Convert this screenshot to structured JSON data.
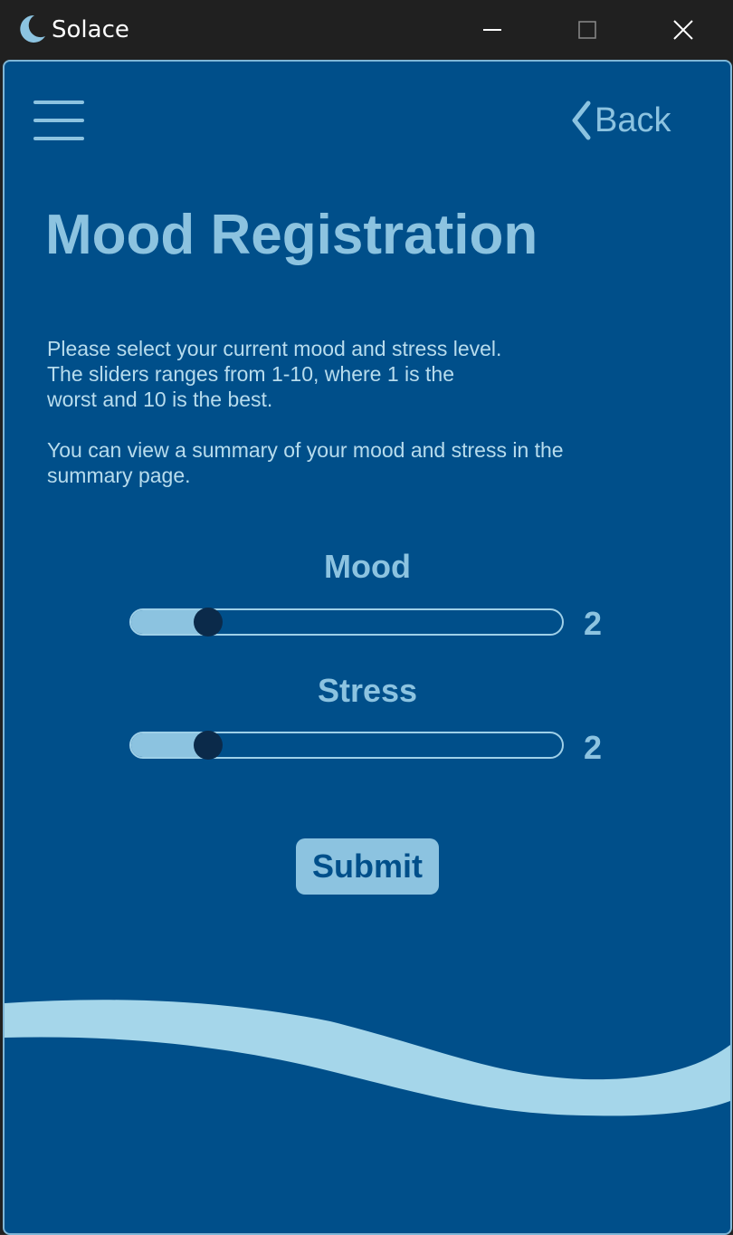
{
  "window": {
    "title": "Solace",
    "icon": "moon-icon",
    "controls": [
      "minimize-icon",
      "maximize-icon",
      "close-icon"
    ]
  },
  "nav": {
    "menu_icon": "hamburger-menu-icon",
    "back_icon": "chevron-left-icon",
    "back_label": "Back"
  },
  "main": {
    "title": "Mood Registration",
    "description_1": "Please select your current mood and stress level.\nThe sliders ranges from 1-10, where 1 is the\nworst and 10 is the best.",
    "description_2": "You can view a summary of your mood and stress in the\nsummary page.",
    "mood": {
      "label": "Mood",
      "value": 2,
      "min": 1,
      "max": 10,
      "display": "2"
    },
    "stress": {
      "label": "Stress",
      "value": 2,
      "min": 1,
      "max": 10,
      "display": "2"
    },
    "submit_label": "Submit"
  },
  "colors": {
    "background": "#004f8a",
    "accent": "#8cc3e0",
    "thumb": "#0b2a4a",
    "titlebar": "#202020"
  }
}
